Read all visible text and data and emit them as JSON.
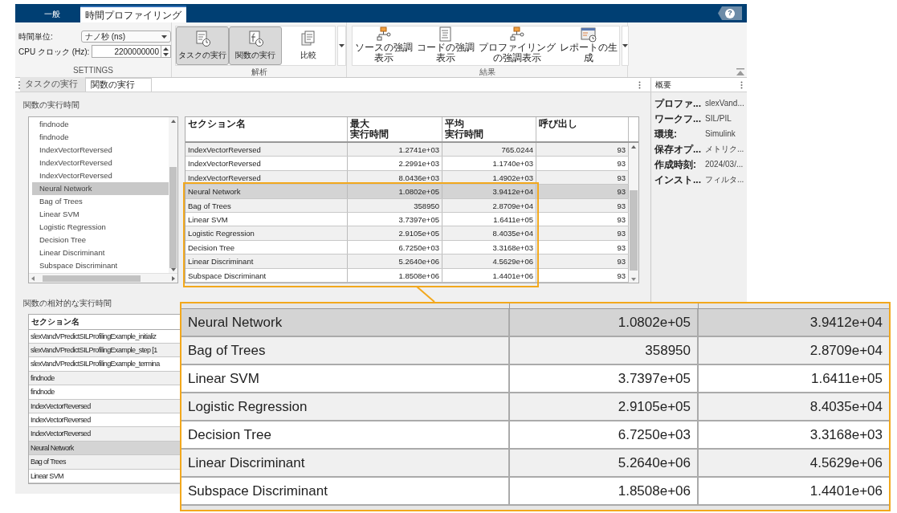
{
  "tabs": [
    {
      "label": "一般",
      "selected": false
    },
    {
      "label": "時間プロファイリング",
      "selected": true
    }
  ],
  "help_button": {
    "label": "?"
  },
  "settings": {
    "section_label": "SETTINGS",
    "time_unit": {
      "label": "時間単位:",
      "value": "ナノ秒 (ns)"
    },
    "cpu_clock": {
      "label": "CPU クロック (Hz):",
      "value": "2200000000"
    }
  },
  "analysis": {
    "section_label": "解析",
    "buttons": [
      {
        "label": "タスクの実行",
        "kind": "task",
        "selected": true
      },
      {
        "label": "関数の実行",
        "kind": "function",
        "selected": true
      },
      {
        "label": "比較",
        "kind": "compare",
        "selected": false
      }
    ]
  },
  "results": {
    "section_label": "結果",
    "buttons": [
      {
        "label": "ソースの強調表示",
        "kind": "blocks"
      },
      {
        "label": "コードの強調表示",
        "kind": "code"
      },
      {
        "label": "プロファイリングの強調表示",
        "kind": "blocks"
      },
      {
        "label": "レポートの生成",
        "kind": "report"
      }
    ]
  },
  "document_tabs": [
    {
      "label": "タスクの実行",
      "selected": false
    },
    {
      "label": "関数の実行",
      "selected": true
    }
  ],
  "function_times": {
    "title": "関数の実行時間",
    "list": [
      {
        "label": "findnode",
        "selected": false
      },
      {
        "label": "findnode",
        "selected": false
      },
      {
        "label": "IndexVectorReversed",
        "selected": false
      },
      {
        "label": "IndexVectorReversed",
        "selected": false
      },
      {
        "label": "IndexVectorReversed",
        "selected": false
      },
      {
        "label": "Neural Network",
        "selected": true
      },
      {
        "label": "Bag of Trees",
        "selected": false
      },
      {
        "label": "Linear SVM",
        "selected": false
      },
      {
        "label": "Logistic Regression",
        "selected": false
      },
      {
        "label": "Decision Tree",
        "selected": false
      },
      {
        "label": "Linear Discriminant",
        "selected": false
      },
      {
        "label": "Subspace Discriminant",
        "selected": false
      }
    ],
    "table": {
      "columns": [
        [
          "セクション名"
        ],
        [
          "最大",
          "実行時間"
        ],
        [
          "平均",
          "実行時間"
        ],
        [
          "呼び出し"
        ]
      ],
      "rows": [
        {
          "name": "IndexVectorReversed",
          "max": "1.2741e+03",
          "avg": "765.0244",
          "calls": "93",
          "selected": false
        },
        {
          "name": "IndexVectorReversed",
          "max": "2.2991e+03",
          "avg": "1.1740e+03",
          "calls": "93",
          "selected": false
        },
        {
          "name": "IndexVectorReversed",
          "max": "8.0436e+03",
          "avg": "1.4902e+03",
          "calls": "93",
          "selected": false
        },
        {
          "name": "Neural Network",
          "max": "1.0802e+05",
          "avg": "3.9412e+04",
          "calls": "93",
          "selected": true
        },
        {
          "name": "Bag of Trees",
          "max": "358950",
          "avg": "2.8709e+04",
          "calls": "93",
          "selected": false
        },
        {
          "name": "Linear SVM",
          "max": "3.7397e+05",
          "avg": "1.6411e+05",
          "calls": "93",
          "selected": false
        },
        {
          "name": "Logistic Regression",
          "max": "2.9105e+05",
          "avg": "8.4035e+04",
          "calls": "93",
          "selected": false
        },
        {
          "name": "Decision Tree",
          "max": "6.7250e+03",
          "avg": "3.3168e+03",
          "calls": "93",
          "selected": false
        },
        {
          "name": "Linear Discriminant",
          "max": "5.2640e+06",
          "avg": "4.5629e+06",
          "calls": "93",
          "selected": false
        },
        {
          "name": "Subspace Discriminant",
          "max": "1.8508e+06",
          "avg": "1.4401e+06",
          "calls": "93",
          "selected": false
        }
      ]
    }
  },
  "relative_times": {
    "title": "関数の相対的な実行時間",
    "table": {
      "columns": [
        "セクション名"
      ],
      "rows": [
        {
          "name": "slexVandVPredictSILProfilingExample_initializ",
          "selected": false
        },
        {
          "name": "slexVandVPredictSILProfilingExample_step [1",
          "selected": false
        },
        {
          "name": "slexVandVPredictSILProfilingExample_termina",
          "selected": false
        },
        {
          "name": "findnode",
          "selected": false
        },
        {
          "name": "findnode",
          "selected": false
        },
        {
          "name": "IndexVectorReversed",
          "selected": false
        },
        {
          "name": "IndexVectorReversed",
          "selected": false
        },
        {
          "name": "IndexVectorReversed",
          "selected": false
        },
        {
          "name": "Neural Network",
          "selected": true
        },
        {
          "name": "Bag of Trees",
          "selected": false
        },
        {
          "name": "Linear SVM",
          "selected": false
        }
      ]
    }
  },
  "summary": {
    "title": "概要",
    "properties": [
      {
        "key": "プロファ...",
        "value": "slexVand..."
      },
      {
        "key": "ワークフ...",
        "value": "SIL/PIL"
      },
      {
        "key": "環境:",
        "value": "Simulink"
      },
      {
        "key": "保存オプ...",
        "value": "メトリク..."
      },
      {
        "key": "作成時刻:",
        "value": "2024/03/..."
      },
      {
        "key": "インスト...",
        "value": "フィルタ..."
      }
    ]
  },
  "zoom_callout": {
    "rows": [
      {
        "name": "Neural Network",
        "max": "1.0802e+05",
        "avg": "3.9412e+04",
        "selected": true
      },
      {
        "name": "Bag of Trees",
        "max": "358950",
        "avg": "2.8709e+04",
        "selected": false
      },
      {
        "name": "Linear SVM",
        "max": "3.7397e+05",
        "avg": "1.6411e+05",
        "selected": false
      },
      {
        "name": "Logistic Regression",
        "max": "2.9105e+05",
        "avg": "8.4035e+04",
        "selected": false
      },
      {
        "name": "Decision Tree",
        "max": "6.7250e+03",
        "avg": "3.3168e+03",
        "selected": false
      },
      {
        "name": "Linear Discriminant",
        "max": "5.2640e+06",
        "avg": "4.5629e+06",
        "selected": false
      },
      {
        "name": "Subspace Discriminant",
        "max": "1.8508e+06",
        "avg": "1.4401e+06",
        "selected": false
      }
    ]
  }
}
